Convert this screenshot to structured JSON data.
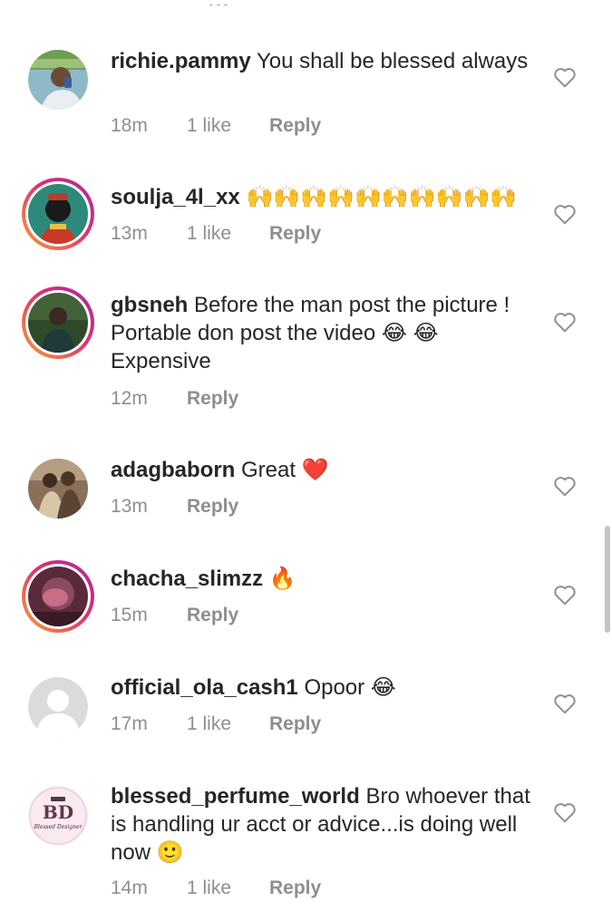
{
  "comments": [
    {
      "username": "richie.pammy",
      "text": "You shall be blessed always",
      "time": "18m",
      "likes": "1 like",
      "reply": "Reply"
    },
    {
      "username": "soulja_4l_xx",
      "text": "🙌🙌🙌🙌🙌🙌🙌🙌🙌🙌",
      "time": "13m",
      "likes": "1 like",
      "reply": "Reply"
    },
    {
      "username": "gbsneh",
      "text": "Before the man post the picture ! Portable don post the video 😂 😂 Expensive",
      "time": "12m",
      "reply": "Reply"
    },
    {
      "username": "adagbaborn",
      "text": "Great ❤️",
      "time": "13m",
      "reply": "Reply"
    },
    {
      "username": "chacha_slimzz",
      "text": "🔥",
      "time": "15m",
      "reply": "Reply"
    },
    {
      "username": "official_ola_cash1",
      "text": "Opoor 😂",
      "time": "17m",
      "likes": "1 like",
      "reply": "Reply"
    },
    {
      "username": "blessed_perfume_world",
      "text": "Bro  whoever that is handling ur acct or advice...is doing well now 🙂",
      "time": "14m",
      "likes": "1 like",
      "reply": "Reply",
      "avatar_logo_text": "Blessed Designer"
    }
  ],
  "colors": {
    "text_primary": "#262626",
    "text_secondary": "#8e8e8e",
    "story_ring_start": "#f9a13a",
    "story_ring_mid": "#e1306c",
    "story_ring_end": "#a52aa6",
    "heart_outline": "#8e8e8e",
    "scrollbar": "#c4c4c4"
  },
  "icons": {
    "like": "heart-outline-icon",
    "default_avatar": "default-user-avatar-icon"
  }
}
